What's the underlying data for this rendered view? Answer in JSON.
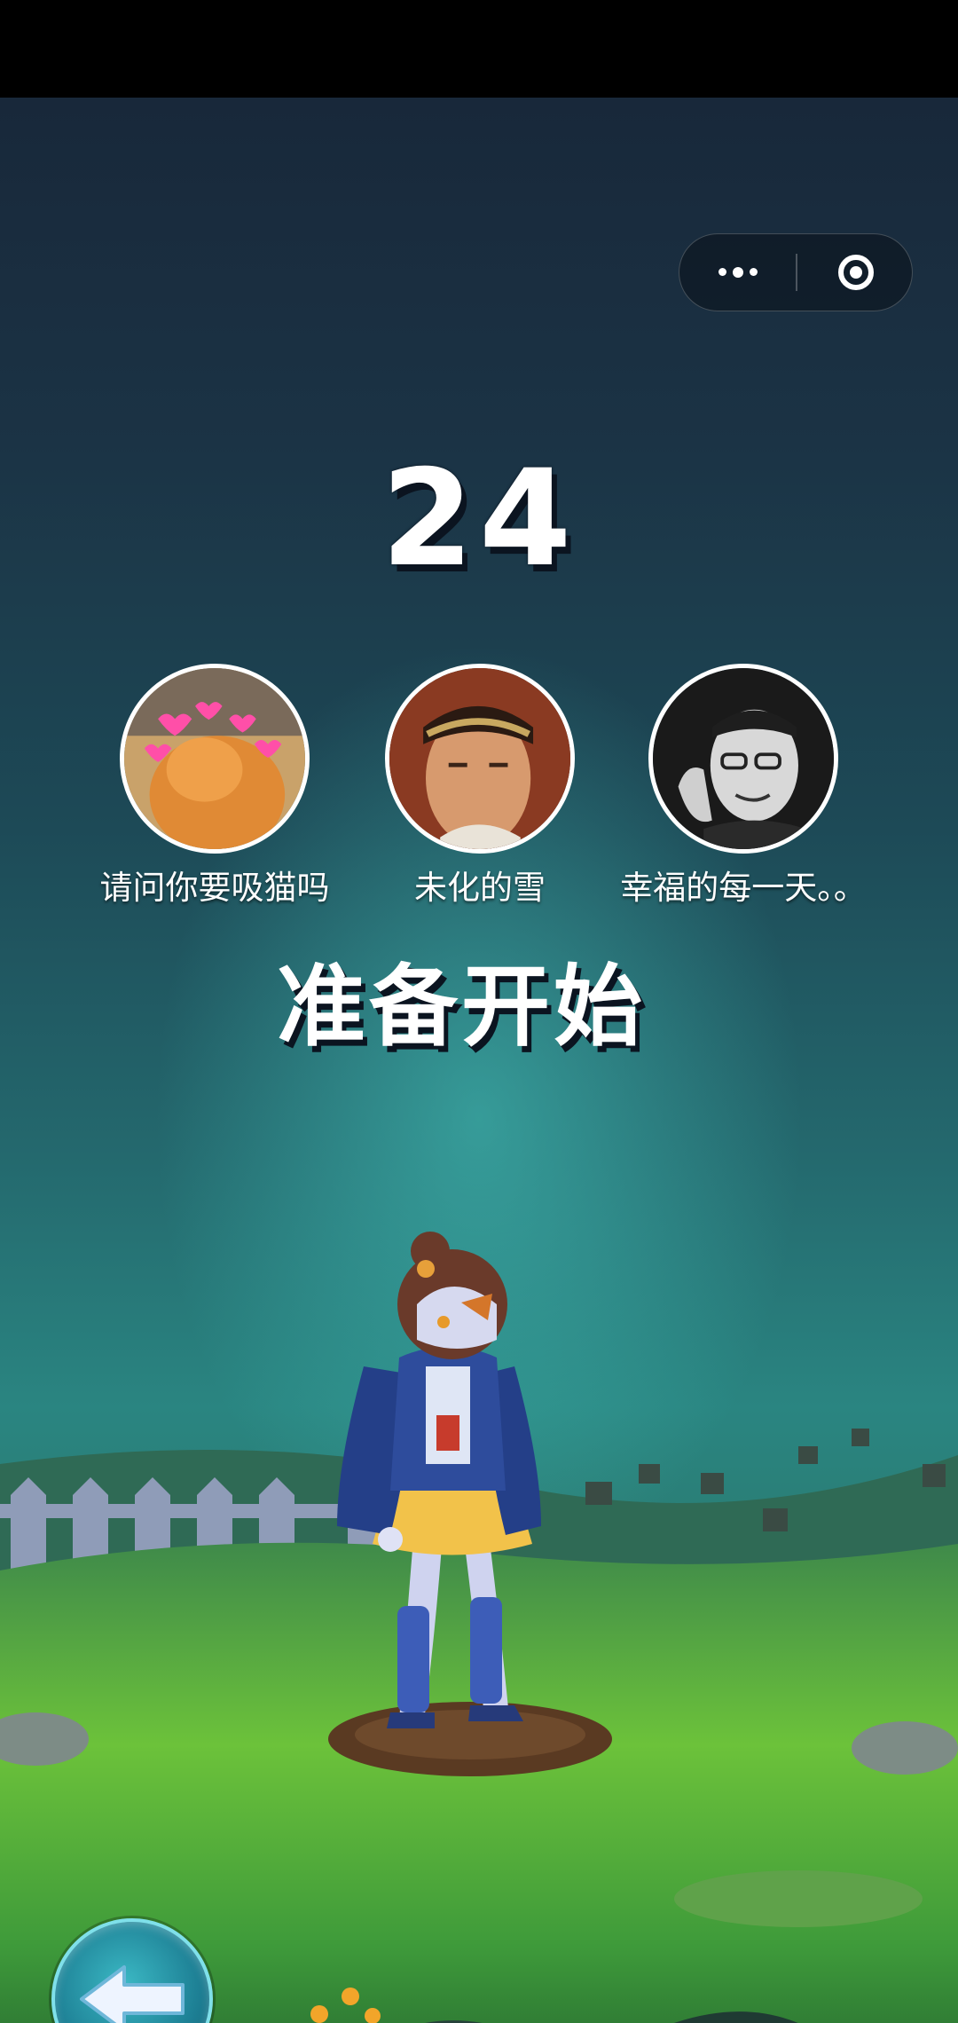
{
  "capsule": {
    "more_icon": "more-dots-icon",
    "close_icon": "target-close-icon"
  },
  "countdown": {
    "value": "24"
  },
  "players": [
    {
      "name": "请问你要吸猫吗",
      "avatar": "cat-with-hearts-photo"
    },
    {
      "name": "未化的雪",
      "avatar": "monkey-king-headband-photo"
    },
    {
      "name": "幸福的每一天。。",
      "avatar": "man-with-glasses-photo"
    }
  ],
  "status": {
    "label": "准备开始"
  },
  "controls": {
    "back_icon": "back-arrow-icon"
  },
  "colors": {
    "text": "#ffffff",
    "text_shadow": "#0b1420",
    "button": "#1d7f94"
  }
}
